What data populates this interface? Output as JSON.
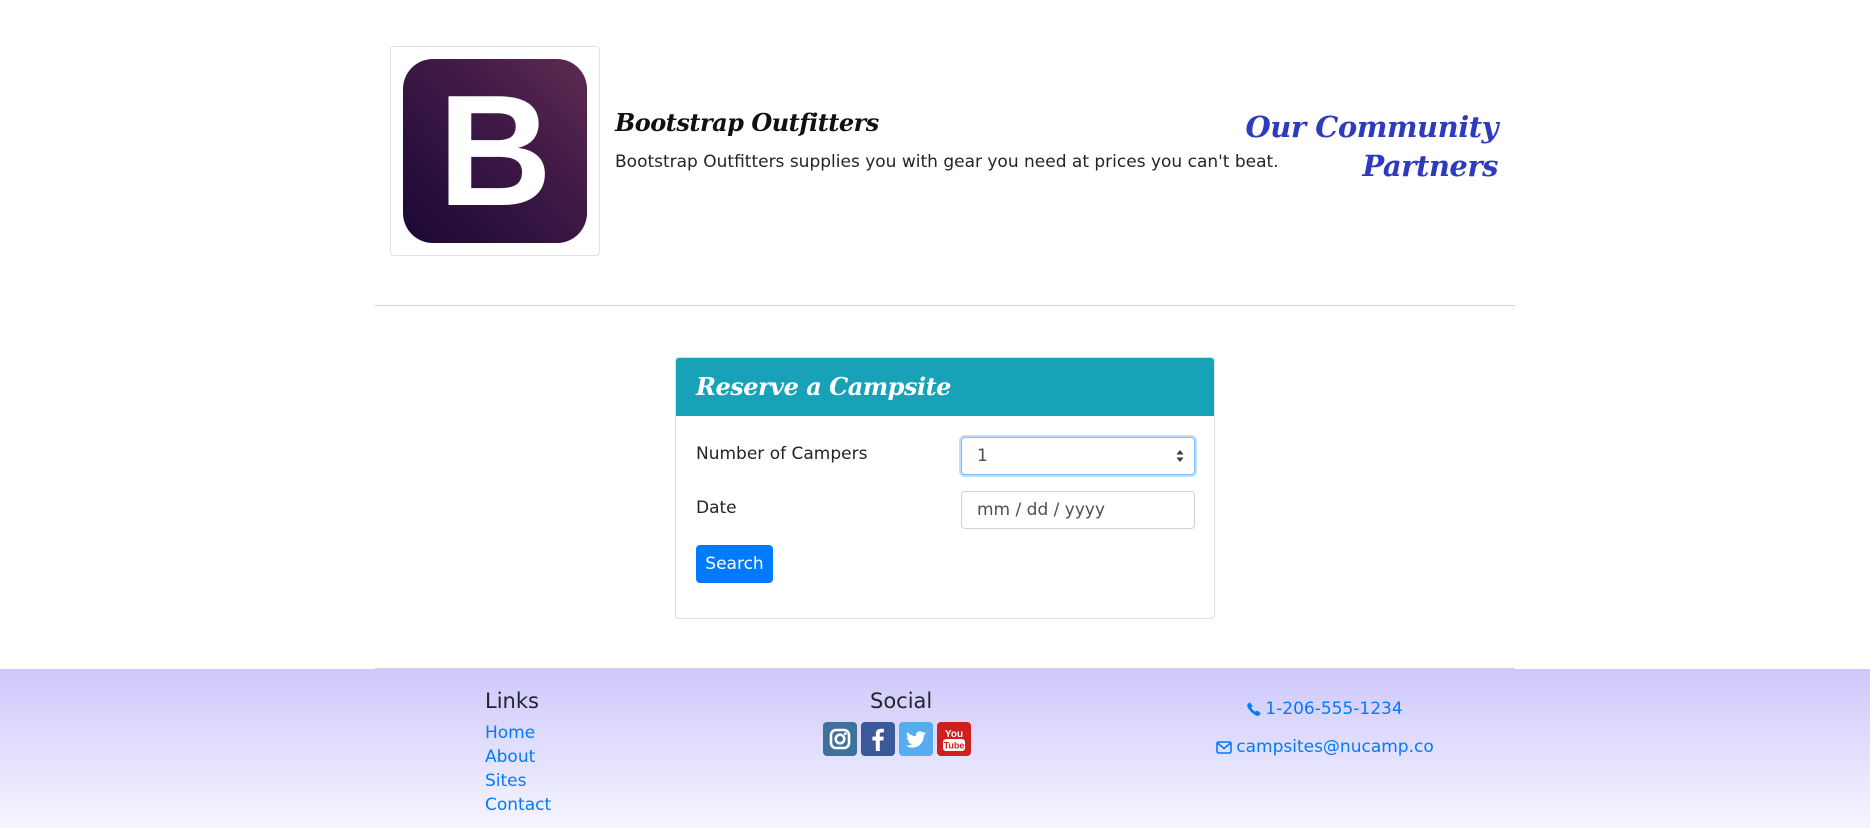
{
  "partner": {
    "logo_letter": "B",
    "name": "Bootstrap Outfitters",
    "description": "Bootstrap Outfitters supplies you with gear you need at prices you can't beat.",
    "community_heading": "Our Community Partners"
  },
  "reserve": {
    "title": "Reserve a Campsite",
    "campers_label": "Number of Campers",
    "campers_value": "1",
    "date_label": "Date",
    "date_placeholder": "mm / dd / yyyy",
    "search_label": "Search"
  },
  "footer": {
    "links_heading": "Links",
    "links": [
      "Home",
      "About",
      "Sites",
      "Contact"
    ],
    "social_heading": "Social",
    "social_icons": [
      "instagram-icon",
      "facebook-icon",
      "twitter-icon",
      "youtube-icon"
    ],
    "youtube_you": "You",
    "youtube_tube": "Tube",
    "phone": "1-206-555-1234",
    "email": "campsites@nucamp.co"
  },
  "colors": {
    "card_header": "#17a2b8",
    "primary": "#007bff",
    "community_heading": "#2f3bbf",
    "instagram": "#3f729b",
    "facebook": "#3b5998",
    "twitter": "#55acee",
    "youtube": "#cd201f"
  }
}
